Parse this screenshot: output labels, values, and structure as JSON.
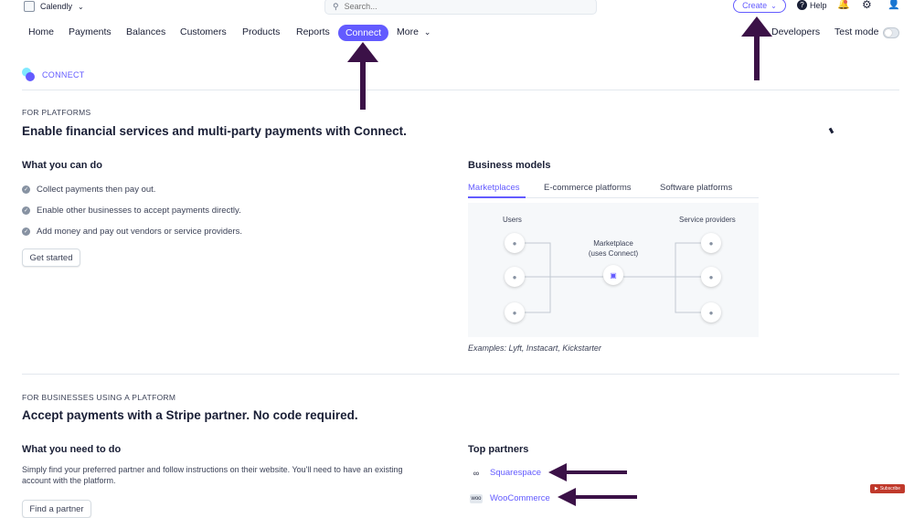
{
  "topbar": {
    "account_name": "Calendly",
    "search_placeholder": "Search...",
    "create_label": "Create",
    "help_label": "Help"
  },
  "nav": {
    "items": [
      "Home",
      "Payments",
      "Balances",
      "Customers",
      "Products",
      "Reports",
      "Connect",
      "More"
    ],
    "active": "Connect",
    "developers": "Developers",
    "test_mode": "Test mode"
  },
  "brand": {
    "label": "CONNECT"
  },
  "platforms": {
    "eyebrow": "FOR PLATFORMS",
    "title": "Enable financial services and multi-party payments with Connect.",
    "what_title": "What you can do",
    "bullets": [
      "Collect payments then pay out.",
      "Enable other businesses to accept payments directly.",
      "Add money and pay out vendors or service providers."
    ],
    "get_started": "Get started"
  },
  "business_models": {
    "title": "Business models",
    "tabs": [
      "Marketplaces",
      "E-commerce platforms",
      "Software platforms"
    ],
    "active_tab": "Marketplaces",
    "users_label": "Users",
    "providers_label": "Service providers",
    "center_line1": "Marketplace",
    "center_line2": "(uses Connect)",
    "examples": "Examples: Lyft, Instacart, Kickstarter"
  },
  "businesses": {
    "eyebrow": "FOR BUSINESSES USING A PLATFORM",
    "title": "Accept payments with a Stripe partner. No code required.",
    "need_title": "What you need to do",
    "description": "Simply find your preferred partner and follow instructions on their website. You'll need to have an existing account with the platform.",
    "find_partner": "Find a partner",
    "partners_title": "Top partners",
    "partners": [
      "Squarespace",
      "WooCommerce"
    ]
  },
  "overlay": {
    "youtube_label": "Subscribe",
    "annotation_color": "#3b1147"
  },
  "colors": {
    "accent": "#635bff",
    "text": "#1a1f36",
    "muted": "#697386"
  }
}
